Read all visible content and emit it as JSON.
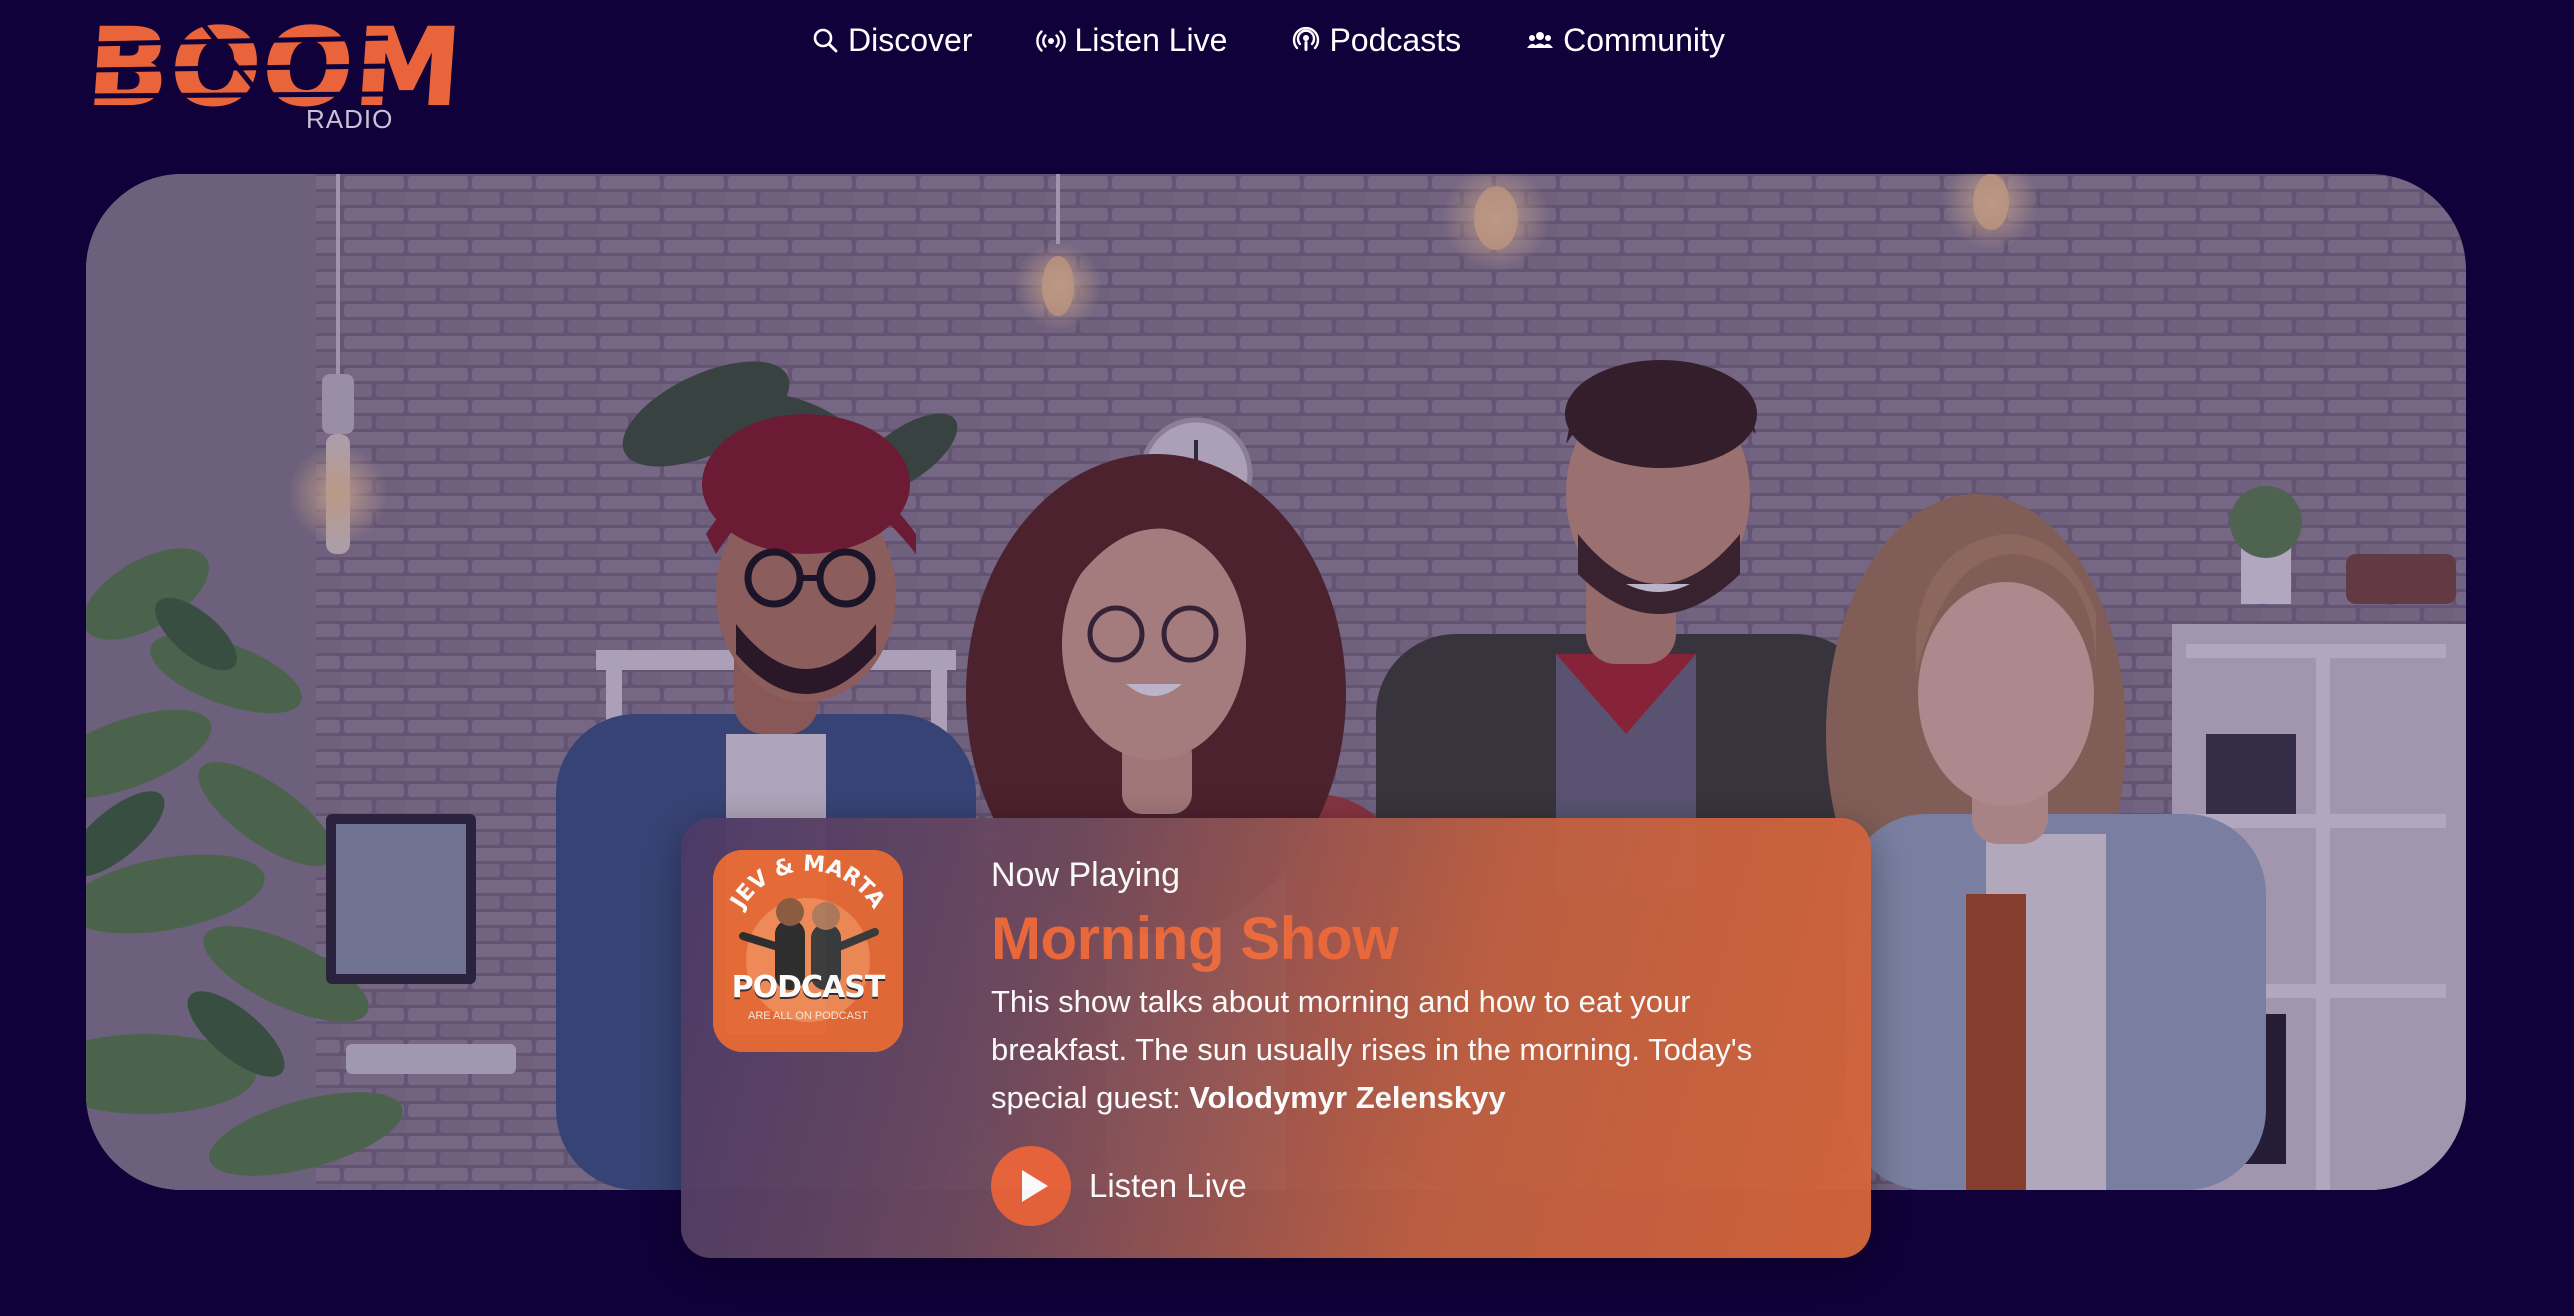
{
  "logo": {
    "word": "BOOM",
    "sub": "RADIO"
  },
  "nav": {
    "items": [
      {
        "label": "Discover",
        "icon": "search-icon"
      },
      {
        "label": "Listen Live",
        "icon": "broadcast-icon"
      },
      {
        "label": "Podcasts",
        "icon": "podcast-icon"
      },
      {
        "label": "Community",
        "icon": "people-icon"
      }
    ]
  },
  "hero": {
    "image": "group-of-four-people-in-studio-photo"
  },
  "now_playing": {
    "label": "Now Playing",
    "title": "Morning Show",
    "description": "This show talks about morning and how to eat your breakfast. The sun usually rises in the morning. Today's special guest: ",
    "guest": "Volodymyr Zelenskyy",
    "listen_label": "Listen Live",
    "cover": {
      "top_text": "JEV & MARTA",
      "title": "PODCAST",
      "sub": "ARE ALL ON PODCAST"
    }
  },
  "colors": {
    "background": "#11013a",
    "accent": "#e9643a",
    "text": "#ffffff"
  }
}
